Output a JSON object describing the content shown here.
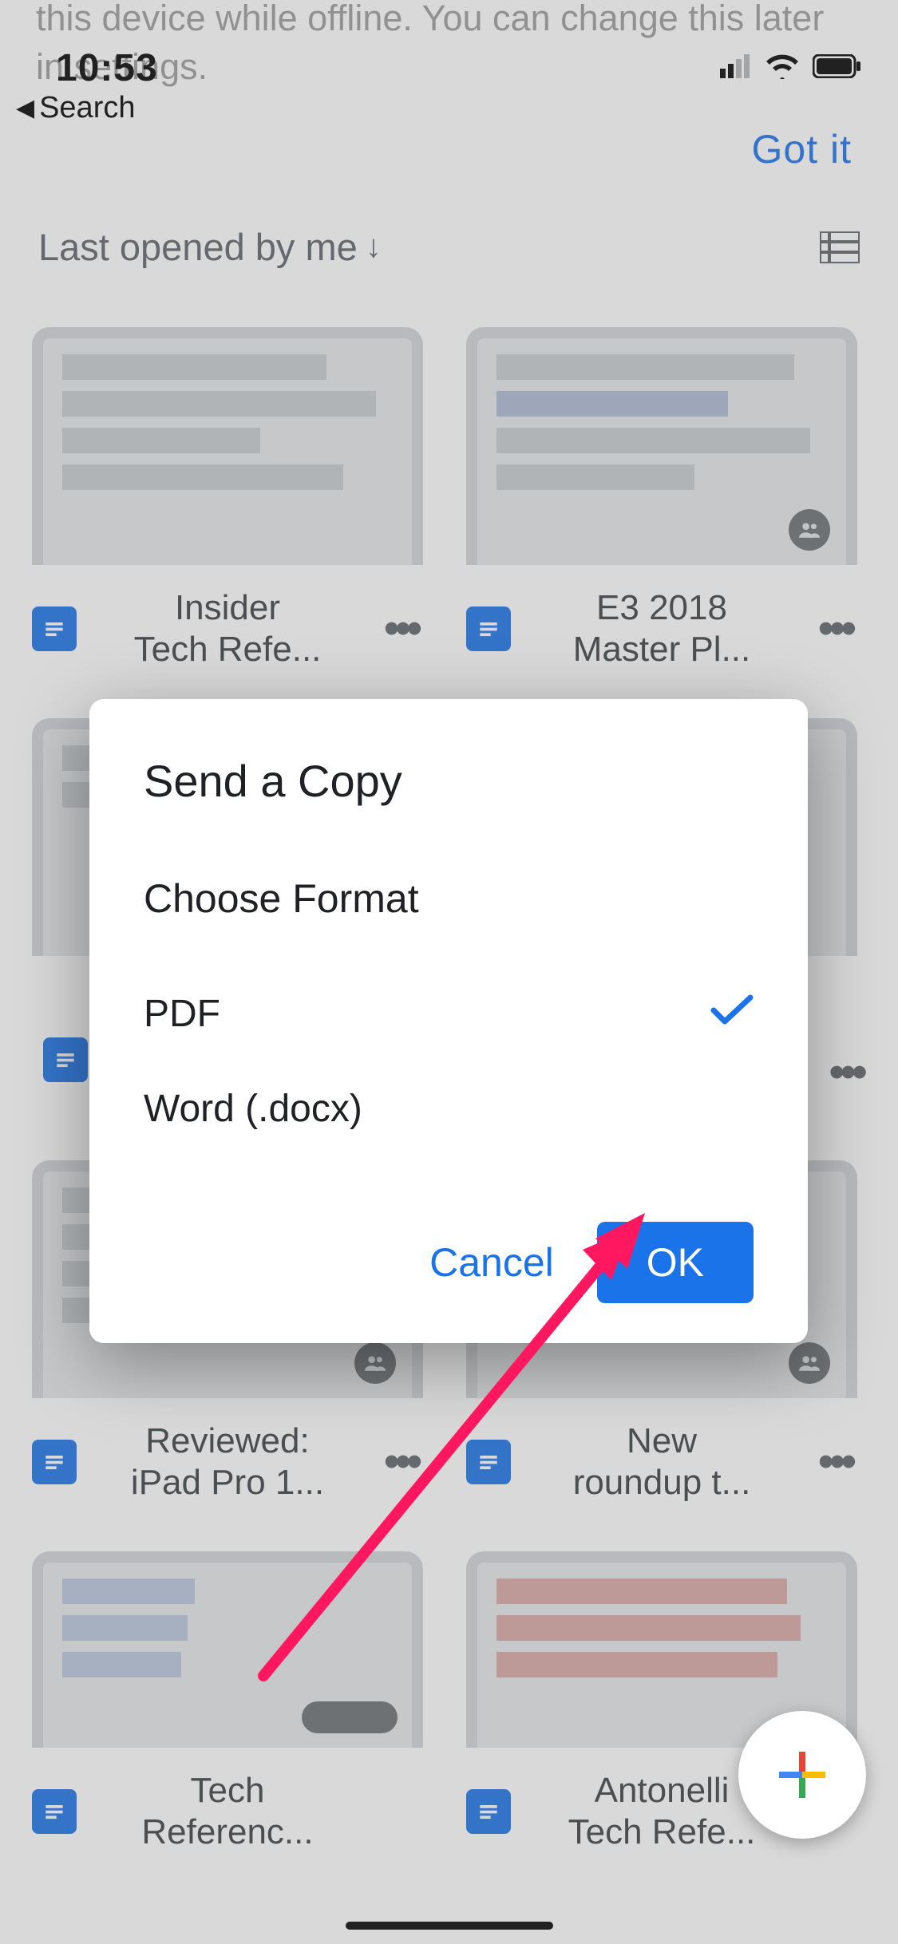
{
  "status": {
    "time": "10:53",
    "back_label": "Search"
  },
  "banner": {
    "line1": "this device while offline. You can change this later",
    "line2": "in settings.",
    "gotit": "Got it"
  },
  "sort": {
    "label": "Last opened by me"
  },
  "docs": [
    {
      "line1": "Insider",
      "line2": "Tech Refe...",
      "shared": false
    },
    {
      "line1": "E3 2018",
      "line2": "Master Pl...",
      "shared": true
    },
    {
      "line1": "Reviewed:",
      "line2": "iPad Pro 1...",
      "shared": true
    },
    {
      "line1": "New",
      "line2": "roundup t...",
      "shared": true
    },
    {
      "line1": "Tech",
      "line2": "Referenc...",
      "shared_group": true
    },
    {
      "line1": "Antonelli",
      "line2": "Tech Refe...",
      "shared": false
    }
  ],
  "dialog": {
    "title": "Send a Copy",
    "subtitle": "Choose Format",
    "options": {
      "pdf": "PDF",
      "word": "Word (.docx)"
    },
    "selected": "pdf",
    "cancel": "Cancel",
    "ok": "OK"
  }
}
